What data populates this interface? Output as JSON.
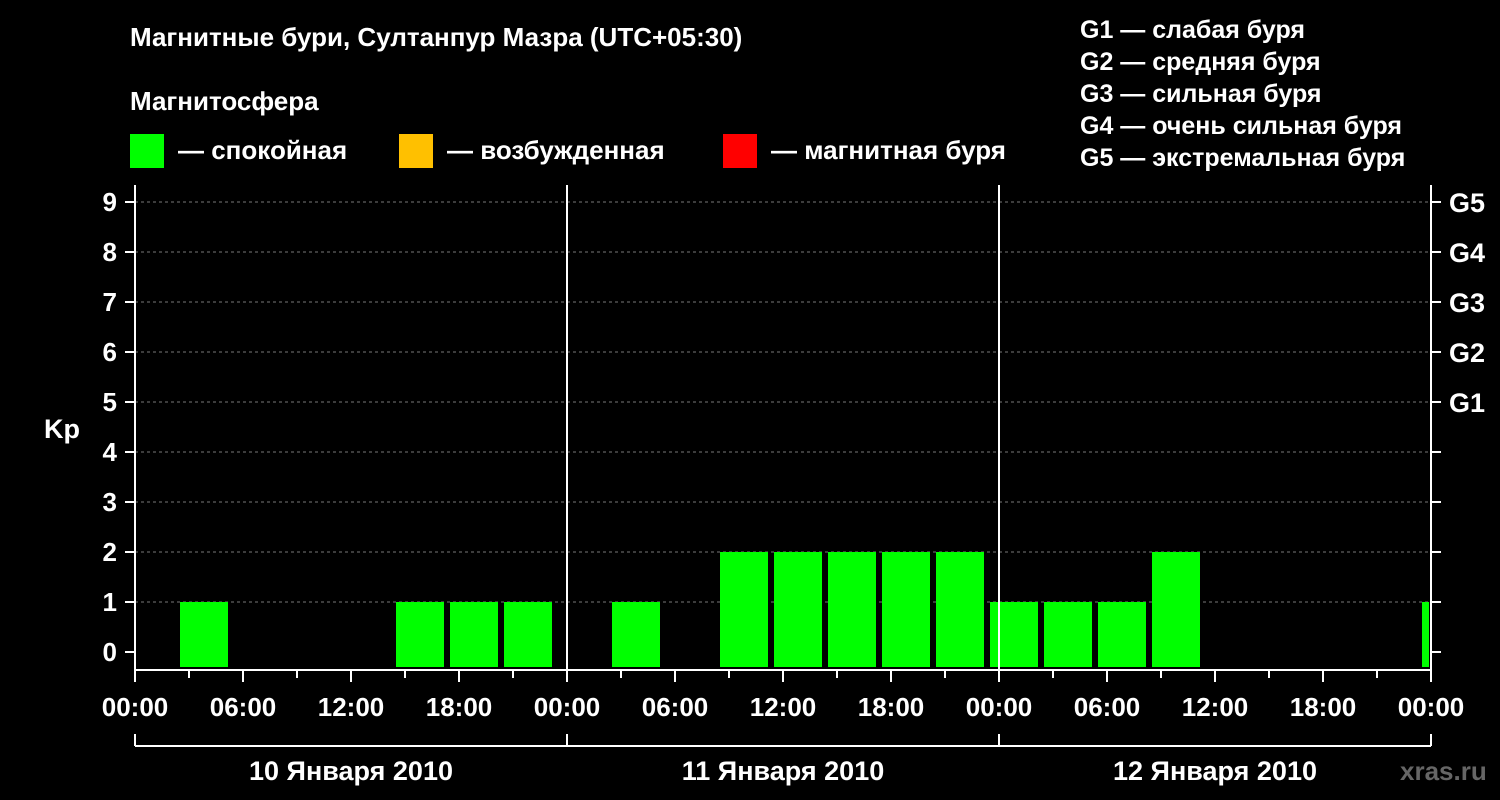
{
  "title": "Магнитные бури, Султанпур Мазра (UTC+05:30)",
  "magnetosphere_label": "Магнитосфера",
  "legend": [
    {
      "label": "— спокойная",
      "color": "#00ff00"
    },
    {
      "label": "— возбужденная",
      "color": "#ffc000"
    },
    {
      "label": "— магнитная буря",
      "color": "#ff0000"
    }
  ],
  "g_scale": [
    "G1 — слабая буря",
    "G2 — средняя буря",
    "G3 — сильная буря",
    "G4 — очень сильная буря",
    "G5 — экстремальная буря"
  ],
  "watermark": "xras.ru",
  "chart_data": {
    "type": "bar",
    "ylabel": "Kp",
    "ylim": [
      0,
      9
    ],
    "yticks": [
      "0",
      "1",
      "2",
      "3",
      "4",
      "5",
      "6",
      "7",
      "8",
      "9"
    ],
    "right_axis_labels": [
      {
        "kp": 5,
        "label": "G1"
      },
      {
        "kp": 6,
        "label": "G2"
      },
      {
        "kp": 7,
        "label": "G3"
      },
      {
        "kp": 8,
        "label": "G4"
      },
      {
        "kp": 9,
        "label": "G5"
      }
    ],
    "xtick_labels": [
      "00:00",
      "06:00",
      "12:00",
      "18:00",
      "00:00",
      "06:00",
      "12:00",
      "18:00",
      "00:00",
      "06:00",
      "12:00",
      "18:00",
      "00:00"
    ],
    "days": [
      "10 Января 2010",
      "11 Января 2010",
      "12 Января 2010"
    ],
    "bar_interval_hours": 3,
    "bars": [
      {
        "start_hour": 2.5,
        "kp": 1,
        "status": "calm"
      },
      {
        "start_hour": 5.5,
        "kp": 0,
        "status": "calm"
      },
      {
        "start_hour": 8.5,
        "kp": 0,
        "status": "calm"
      },
      {
        "start_hour": 11.5,
        "kp": 0,
        "status": "calm"
      },
      {
        "start_hour": 14.5,
        "kp": 1,
        "status": "calm"
      },
      {
        "start_hour": 17.5,
        "kp": 1,
        "status": "calm"
      },
      {
        "start_hour": 20.5,
        "kp": 1,
        "status": "calm"
      },
      {
        "start_hour": 23.5,
        "kp": 0,
        "status": "calm"
      },
      {
        "start_hour": 26.5,
        "kp": 1,
        "status": "calm"
      },
      {
        "start_hour": 29.5,
        "kp": 0,
        "status": "calm"
      },
      {
        "start_hour": 32.5,
        "kp": 2,
        "status": "calm"
      },
      {
        "start_hour": 35.5,
        "kp": 2,
        "status": "calm"
      },
      {
        "start_hour": 38.5,
        "kp": 2,
        "status": "calm"
      },
      {
        "start_hour": 41.5,
        "kp": 2,
        "status": "calm"
      },
      {
        "start_hour": 44.5,
        "kp": 2,
        "status": "calm"
      },
      {
        "start_hour": 47.5,
        "kp": 1,
        "status": "calm"
      },
      {
        "start_hour": 50.5,
        "kp": 1,
        "status": "calm"
      },
      {
        "start_hour": 53.5,
        "kp": 1,
        "status": "calm"
      },
      {
        "start_hour": 56.5,
        "kp": 2,
        "status": "calm"
      },
      {
        "start_hour": 71.5,
        "kp": 1,
        "status": "calm"
      }
    ],
    "status_colors": {
      "calm": "#00ff00",
      "active": "#ffc000",
      "storm": "#ff0000"
    },
    "total_hours": 72,
    "grid": true
  }
}
